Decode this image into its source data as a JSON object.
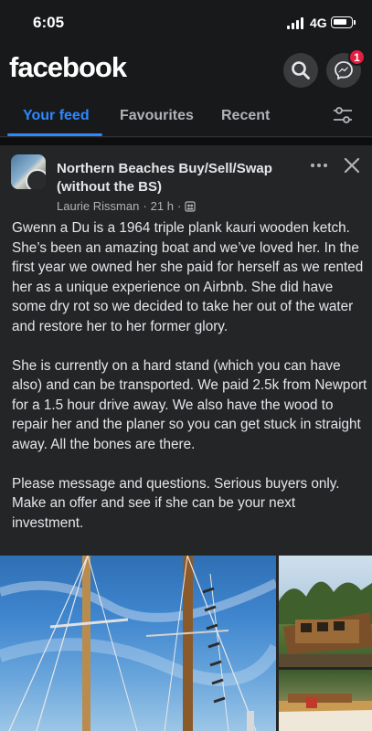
{
  "status_bar": {
    "time": "6:05",
    "network": "4G",
    "battery_level": 0.85
  },
  "header": {
    "logo": "facebook",
    "messenger_badge": "1"
  },
  "tabs": [
    {
      "label": "Your feed",
      "active": true
    },
    {
      "label": "Favourites",
      "active": false
    },
    {
      "label": "Recent",
      "active": false
    }
  ],
  "post": {
    "group_name": "Northern Beaches Buy/Sell/Swap (without the BS)",
    "author": "Laurie Rissman",
    "time": "21 h",
    "separator": "·",
    "paragraphs": [
      "Gwenn a Du is a 1964 triple plank kauri wooden ketch. She’s been an amazing boat and we’ve loved her. In the first year we owned her she paid for herself as we rented her as a unique experience on Airbnb. She did have some dry rot so we decided to take her out of the water and restore her to her former glory.",
      "She is currently on a hard stand (which you can have also) and can be transported. We paid 2.5k from Newport for a 1.5 hour drive away. We also have the wood to repair her and the planer so you can get stuck in straight away. All the bones are there.",
      "Please message and questions. Serious buyers only. Make an offer and see if she can be your next investment."
    ]
  },
  "colors": {
    "accent": "#2d88ff",
    "background": "#18191a",
    "card": "#242526",
    "badge": "#e41e3f"
  },
  "icons": [
    "search-icon",
    "messenger-icon",
    "filter-icon",
    "more-icon",
    "close-icon",
    "members-icon"
  ]
}
